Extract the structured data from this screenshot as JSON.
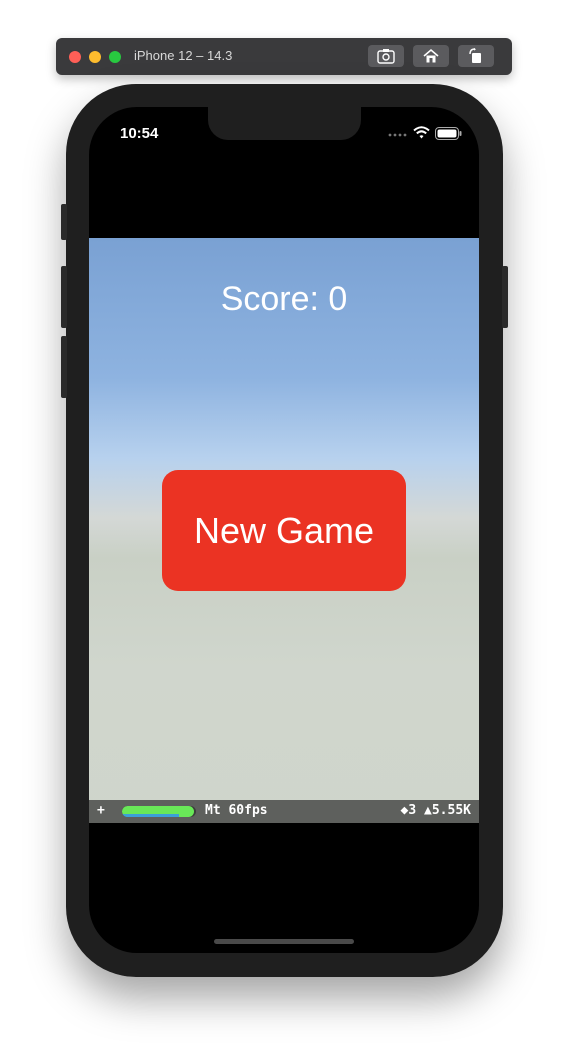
{
  "simulator": {
    "title": "iPhone 12 – 14.3"
  },
  "status_bar": {
    "time": "10:54"
  },
  "game": {
    "score_text": "Score: 0",
    "new_game_label": "New Game"
  },
  "stats_bar": {
    "plus": "+",
    "fps_text": "Mt 60fps",
    "fps_fill_fraction": 0.97,
    "right_text": "◆3 ▲5.55K"
  },
  "colors": {
    "button_red": "#eb3323",
    "sky_top": "#7aa1d3",
    "ground": "#cfd5cb",
    "fps_green": "#69e858"
  },
  "icons": [
    "screenshot-icon",
    "home-icon",
    "rotate-icon",
    "signal-icon",
    "wifi-icon",
    "battery-icon"
  ]
}
